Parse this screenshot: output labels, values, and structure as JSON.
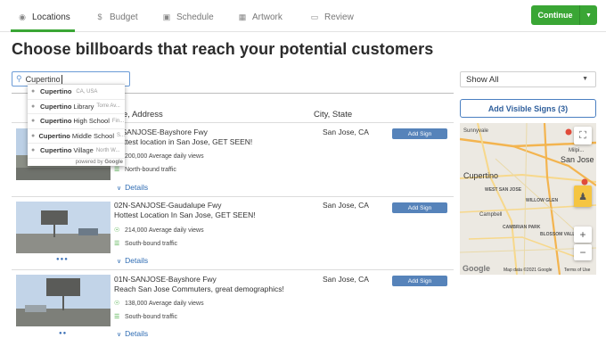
{
  "tabs": [
    {
      "label": "Locations",
      "icon": "map-pin-icon",
      "active": true
    },
    {
      "label": "Budget",
      "icon": "dollar-icon",
      "active": false
    },
    {
      "label": "Schedule",
      "icon": "calendar-icon",
      "active": false
    },
    {
      "label": "Artwork",
      "icon": "image-icon",
      "active": false
    },
    {
      "label": "Review",
      "icon": "monitor-icon",
      "active": false
    }
  ],
  "continue_label": "Continue",
  "page_title": "Choose billboards that reach your potential customers",
  "search": {
    "value": "Cupertino"
  },
  "autocomplete": {
    "items": [
      {
        "match": "Cupertino",
        "rest": "",
        "secondary": "CA, USA"
      },
      {
        "match": "Cupertino",
        "rest": "Library",
        "secondary": "Torre Av..."
      },
      {
        "match": "Cupertino",
        "rest": "High School",
        "secondary": "Fin..."
      },
      {
        "match": "Cupertino",
        "rest": "Middle School",
        "secondary": "S..."
      },
      {
        "match": "Cupertino",
        "rest": "Village",
        "secondary": "North W..."
      }
    ],
    "powered_by": "powered by",
    "powered_brand": "Google"
  },
  "filter": {
    "selected": "Show All"
  },
  "add_visible_label": "Add Visible Signs (3)",
  "table": {
    "col_name": "me, Address",
    "col_city": "City, State"
  },
  "rows": [
    {
      "name": "S-SANJOSE-Bayshore Fwy",
      "desc": "Hottest location in San Jose, GET SEEN!",
      "views": "200,000 Average daily views",
      "traffic": "North-bound traffic",
      "details": "Details",
      "city": "San Jose, CA",
      "add": "Add Sign"
    },
    {
      "name": "02N-SANJOSE-Gaudalupe Fwy",
      "desc": "Hottest Location In San Jose, GET SEEN!",
      "views": "214,000 Average daily views",
      "traffic": "South-bound traffic",
      "details": "Details",
      "city": "San Jose, CA",
      "add": "Add Sign"
    },
    {
      "name": "01N-SANJOSE-Bayshore Fwy",
      "desc": "Reach San Jose Commuters, great demographics!",
      "views": "138,000 Average daily views",
      "traffic": "South-bound traffic",
      "details": "Details",
      "city": "San Jose, CA",
      "add": "Add Sign"
    }
  ],
  "map": {
    "labels": {
      "sunnyvale": "Sunnyvale",
      "cupertino": "Cupertino",
      "san_jose": "San Jose",
      "milpitas": "Milpi...",
      "west_san_jose": "WEST SAN JOSE",
      "willow_glen": "WILLOW GLEN",
      "cambrian": "CAMBRIAN PARK",
      "blossom": "BLOSSOM VALLEY",
      "campbell": "Campbell"
    },
    "map_data": "Map data ©2021 Google",
    "terms": "Terms of Use",
    "logo": "Google",
    "colors": {
      "road": "#f7d88b",
      "highway": "#f3b44f",
      "marker": "#e04b3a"
    }
  }
}
